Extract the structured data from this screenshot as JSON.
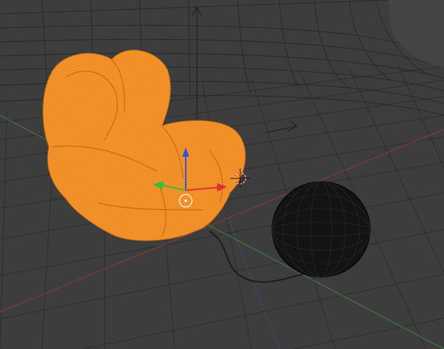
{
  "viewport": {
    "background": "#3d3d3d",
    "grid_color": "#2c2c2c",
    "x_axis_color": "#8a3a3a",
    "y_axis_color": "#3f7a3f",
    "z_axis_color": "#4a4aa0"
  },
  "selected_object": {
    "name": "armchair",
    "display": "wireframe",
    "selected": true,
    "color": "#ff9c33"
  },
  "other_objects": [
    {
      "name": "sphere",
      "display": "wireframe",
      "selected": false,
      "color": "#111111"
    },
    {
      "name": "backdrop",
      "display": "wireframe",
      "selected": false,
      "color": "#262626"
    },
    {
      "name": "cable",
      "display": "wireframe",
      "selected": false,
      "color": "#1c1c1c"
    }
  ],
  "manipulator": {
    "x_axis_color": "#e03030",
    "y_axis_color": "#30c030",
    "z_axis_color": "#3050e0",
    "pivot_color": "#ffffff"
  }
}
